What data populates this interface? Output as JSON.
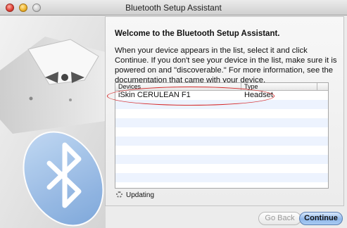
{
  "window": {
    "title": "Bluetooth Setup Assistant"
  },
  "content": {
    "heading": "Welcome to the Bluetooth Setup Assistant.",
    "intro": "When your device appears in the list, select it and click Continue. If you don't see your device in the list, make sure it is powered on and \"discoverable.\" For more information, see the documentation that came with your device."
  },
  "table": {
    "columns": [
      "Devices",
      "Type"
    ],
    "rows": [
      {
        "name": "iSkin CERULEAN F1",
        "type": "Headset"
      }
    ]
  },
  "status": {
    "text": "Updating"
  },
  "buttons": {
    "back": "Go Back",
    "continue": "Continue"
  },
  "icons": {
    "window": [
      "close-icon",
      "minimize-icon",
      "zoom-icon"
    ],
    "illustration": "bluetooth-icon",
    "status": "spinner-icon"
  },
  "colors": {
    "annotation": "#d52a2a",
    "default_button": "#8fb7ea",
    "row_stripe": "#edf3fe"
  }
}
